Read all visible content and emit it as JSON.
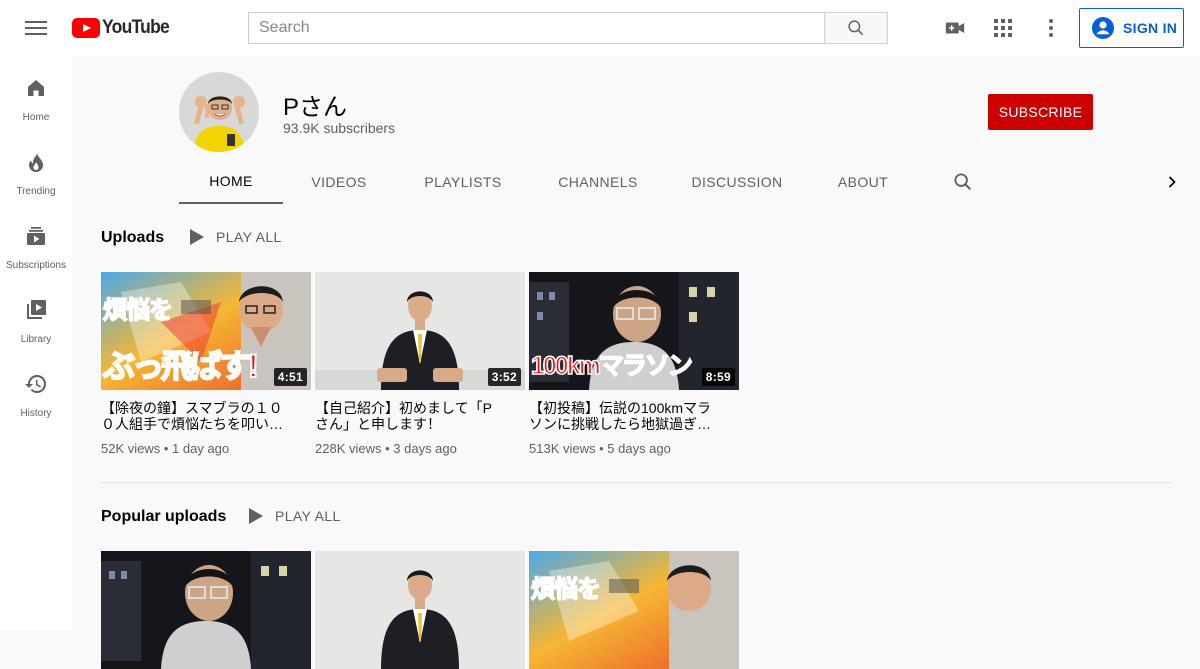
{
  "header": {
    "logo_text": "YouTube",
    "search_placeholder": "Search",
    "sign_in_label": "SIGN IN"
  },
  "sidebar": {
    "items": [
      {
        "label": "Home",
        "icon": "home-icon"
      },
      {
        "label": "Trending",
        "icon": "flame-icon"
      },
      {
        "label": "Subscriptions",
        "icon": "subscriptions-icon"
      },
      {
        "label": "Library",
        "icon": "library-icon"
      },
      {
        "label": "History",
        "icon": "history-icon"
      }
    ]
  },
  "channel": {
    "name": "Pさん",
    "subscribers": "93.9K subscribers",
    "subscribe_label": "SUBSCRIBE",
    "tabs": [
      "HOME",
      "VIDEOS",
      "PLAYLISTS",
      "CHANNELS",
      "DISCUSSION",
      "ABOUT"
    ],
    "active_tab": "HOME"
  },
  "shelves": [
    {
      "title": "Uploads",
      "play_all_label": "PLAY ALL",
      "videos": [
        {
          "title": "【除夜の鐘】スマブラの１０ ０人組手で煩悩たちを叩い…",
          "duration": "4:51",
          "views": "52K views",
          "age": "1 day ago",
          "thumb_text_top": "煩悩を",
          "thumb_text_bottom": "ぶっ飛ばす!"
        },
        {
          "title": "【自己紹介】初めまして「P さん」と申します！",
          "duration": "3:52",
          "views": "228K views",
          "age": "3 days ago"
        },
        {
          "title": "【初投稿】伝説の100kmマラ ソンに挑戦したら地獄過ぎ…",
          "duration": "8:59",
          "views": "513K views",
          "age": "5 days ago",
          "thumb_text": "100kmマラソン"
        }
      ]
    },
    {
      "title": "Popular uploads",
      "play_all_label": "PLAY ALL",
      "videos": [
        {
          "thumb": "night"
        },
        {
          "thumb": "suit"
        },
        {
          "thumb": "smash",
          "thumb_text_top": "煩悩を"
        }
      ]
    }
  ],
  "colors": {
    "brand_red": "#ff0000",
    "subscribe_red": "#cc0000",
    "link_blue": "#065fd4"
  }
}
